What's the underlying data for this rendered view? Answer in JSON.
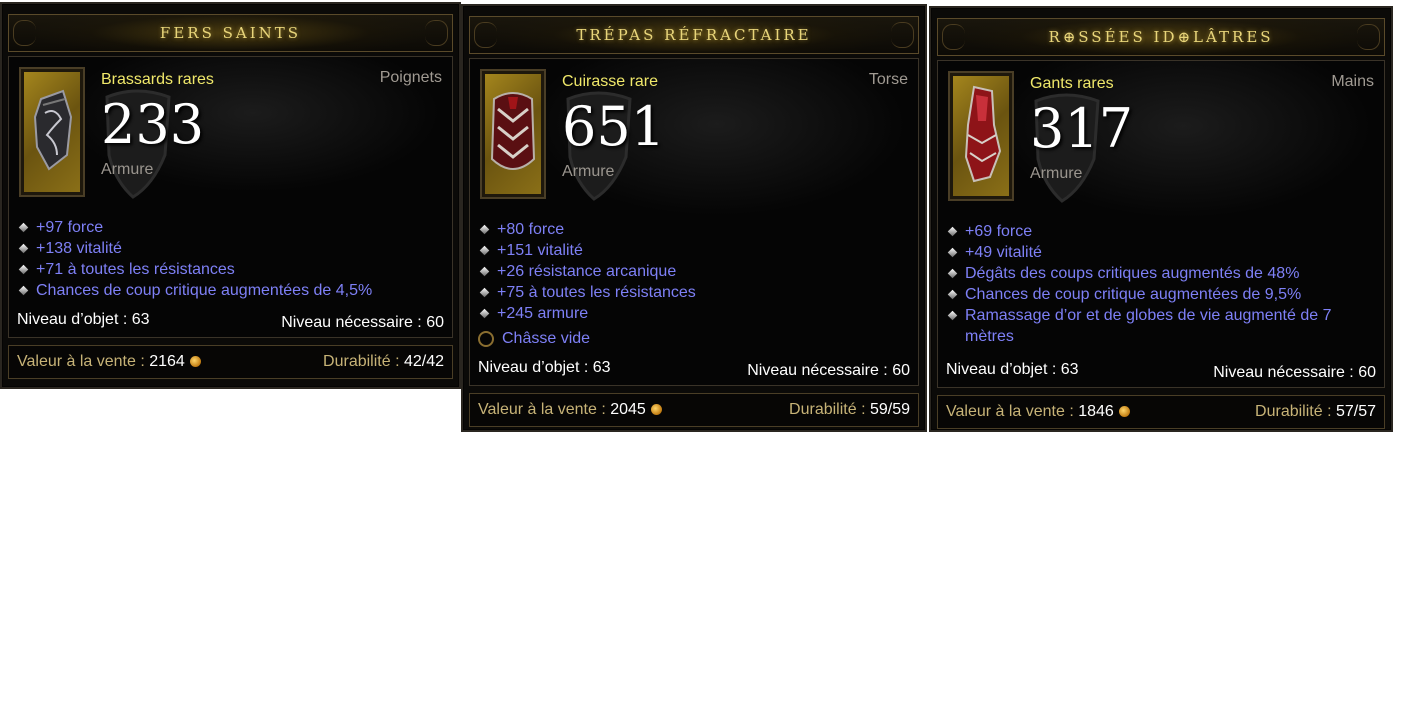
{
  "items": [
    {
      "title": "FERS SAINTS",
      "name": "Brassards rares",
      "slot": "Poignets",
      "armor": "233",
      "armor_label": "Armure",
      "icon": "bracers-icon",
      "affixes": [
        "+97 force",
        "+138 vitalité",
        "+71 à toutes les résistances",
        "Chances de coup critique augmentées de 4,5%"
      ],
      "item_level_label": "Niveau d’objet : ",
      "item_level": "63",
      "required_level_label": "Niveau nécessaire : ",
      "required_level": "60",
      "sell_label": "Valeur à la vente : ",
      "sell_value": "2164",
      "durability_label": "Durabilité : ",
      "durability": "42/42"
    },
    {
      "title": "TRÉPAS RÉFRACTAIRE",
      "name": "Cuirasse rare",
      "slot": "Torse",
      "armor": "651",
      "armor_label": "Armure",
      "icon": "chest-armor-icon",
      "affixes": [
        "+80 force",
        "+151 vitalité",
        "+26 résistance arcanique",
        "+75 à toutes les résistances",
        "+245 armure"
      ],
      "socket": "Châsse vide",
      "item_level_label": "Niveau d’objet : ",
      "item_level": "63",
      "required_level_label": "Niveau nécessaire : ",
      "required_level": "60",
      "sell_label": "Valeur à la vente : ",
      "sell_value": "2045",
      "durability_label": "Durabilité : ",
      "durability": "59/59"
    },
    {
      "title": "R⊕SSÉES ID⊕LÂTRES",
      "name": "Gants rares",
      "slot": "Mains",
      "armor": "317",
      "armor_label": "Armure",
      "icon": "gloves-icon",
      "affixes": [
        "+69 force",
        "+49 vitalité",
        "Dégâts des coups critiques augmentés de 48%",
        "Chances de coup critique augmentées de 9,5%",
        "Ramassage d’or et de globes de vie augmenté de 7 mètres"
      ],
      "item_level_label": "Niveau d’objet : ",
      "item_level": "63",
      "required_level_label": "Niveau nécessaire : ",
      "required_level": "60",
      "sell_label": "Valeur à la vente : ",
      "sell_value": "1846",
      "durability_label": "Durabilité : ",
      "durability": "57/57"
    }
  ],
  "colors": {
    "title": "#e8d57a",
    "item_name": "#f0e86a",
    "affix": "#7e80f6",
    "footer_label": "#c7b377"
  }
}
